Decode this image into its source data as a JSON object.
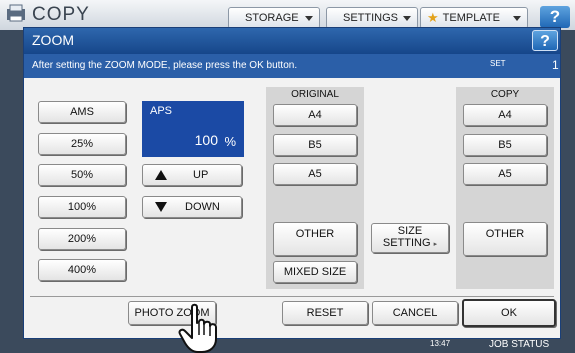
{
  "topbar": {
    "title": "COPY",
    "storage_label": "STORAGE",
    "settings_label": "SETTINGS",
    "template_label": "TEMPLATE",
    "help_label": "?"
  },
  "dialog": {
    "title": "ZOOM",
    "help_label": "?",
    "message": "After setting the ZOOM MODE, please press the OK button.",
    "set_label": "SET",
    "set_count": "1"
  },
  "zoom_buttons": [
    "AMS",
    "25%",
    "50%",
    "100%",
    "200%",
    "400%"
  ],
  "aps": {
    "label": "APS",
    "value": "100",
    "unit": "%"
  },
  "adjust": {
    "up_label": "UP",
    "down_label": "DOWN"
  },
  "original": {
    "title": "ORIGINAL",
    "sizes": [
      "A4",
      "B5",
      "A5"
    ],
    "other_label": "OTHER",
    "mixed_label": "MIXED SIZE"
  },
  "size_setting": {
    "line1": "SIZE",
    "line2": "SETTING"
  },
  "copy": {
    "title": "COPY",
    "sizes": [
      "A4",
      "B5",
      "A5"
    ],
    "other_label": "OTHER"
  },
  "bottom": {
    "photo_zoom_label": "PHOTO ZOOM",
    "reset_label": "RESET",
    "cancel_label": "CANCEL",
    "ok_label": "OK"
  },
  "status": {
    "time": "13:47",
    "job_status_label": "JOB STATUS"
  },
  "colors": {
    "accent_blue": "#1b4aa5",
    "title_blue": "#16468a",
    "panel_gray": "#d5d5d5"
  }
}
